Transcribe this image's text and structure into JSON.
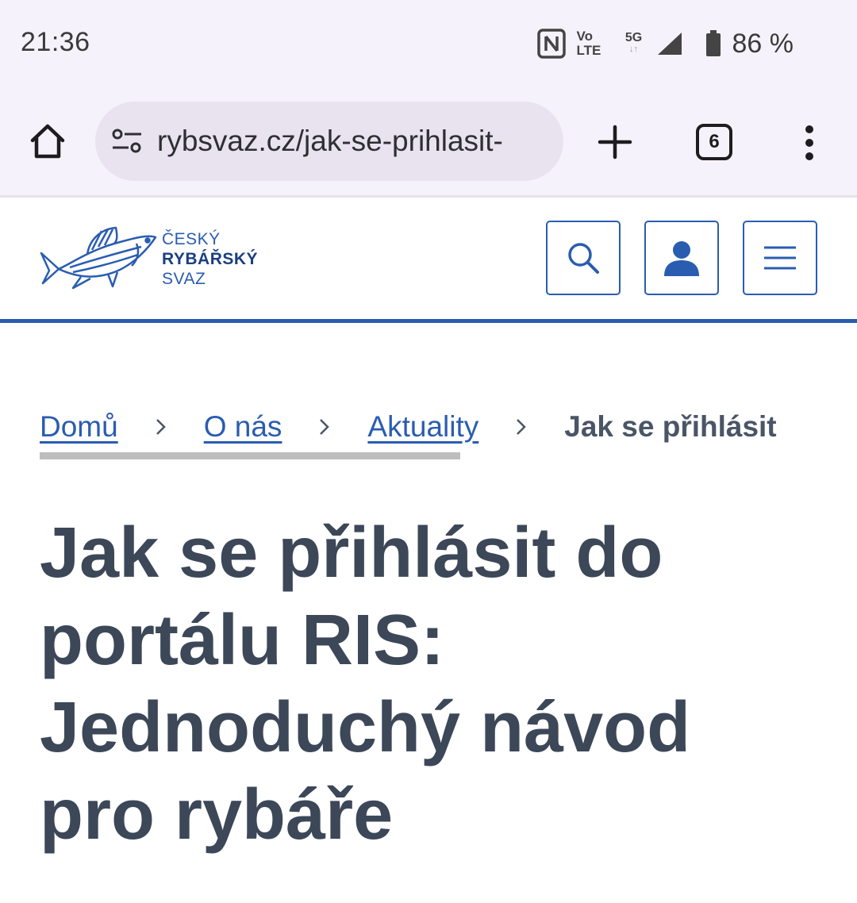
{
  "status_bar": {
    "time": "21:36",
    "volte_top": "Vo",
    "volte_bottom": "LTE",
    "network": "5G",
    "network_arrows": "↓↑",
    "battery": "86 %"
  },
  "browser": {
    "url": "rybsvaz.cz/jak-se-prihlasit-",
    "tab_count": "6"
  },
  "site": {
    "logo_line1": "ČESKÝ",
    "logo_line2": "RYBÁŘSKÝ",
    "logo_line3": "SVAZ",
    "brand_color": "#2a5db0"
  },
  "breadcrumb": {
    "items": [
      {
        "label": "Domů"
      },
      {
        "label": "O nás"
      },
      {
        "label": "Aktuality"
      }
    ],
    "current": "Jak se přihlásit"
  },
  "page": {
    "title": "Jak se přihlásit do portálu RIS: Jednoduchý návod pro rybáře"
  }
}
